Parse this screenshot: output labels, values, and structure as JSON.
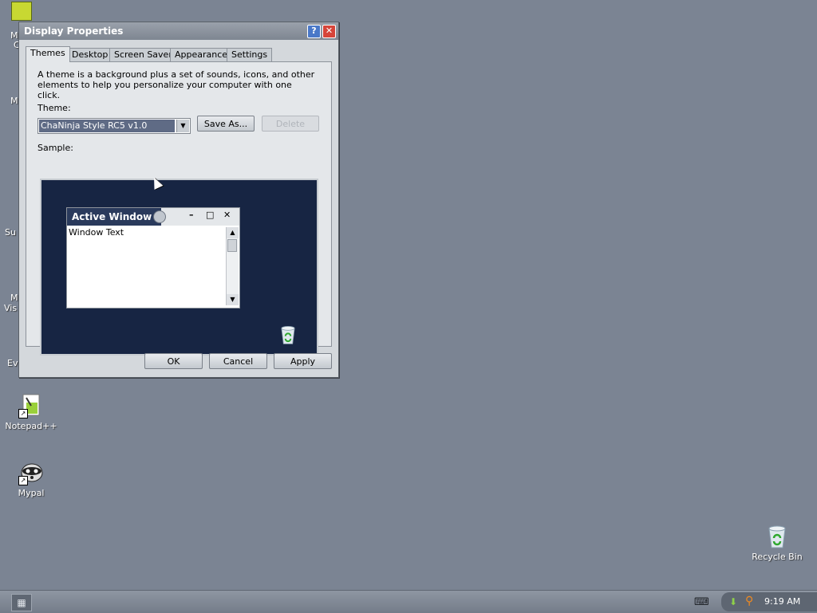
{
  "desktop": {
    "icons": [
      {
        "label": "Notepad++"
      },
      {
        "label": "Mypal"
      },
      {
        "label": "Recycle Bin"
      }
    ],
    "partial_labels": [
      "M",
      "C",
      "M",
      "Su",
      "M",
      "Vis",
      "Ev"
    ]
  },
  "dialog": {
    "title": "Display Properties",
    "help_glyph": "?",
    "close_glyph": "✕",
    "tabs": [
      {
        "label": "Themes",
        "active": true
      },
      {
        "label": "Desktop"
      },
      {
        "label": "Screen Saver"
      },
      {
        "label": "Appearance"
      },
      {
        "label": "Settings"
      }
    ],
    "description": "A theme is a background plus a set of sounds, icons, and other elements to help you personalize your computer with one click.",
    "theme_label": "Theme:",
    "theme_value": "ChaNinja Style RC5 v1.0",
    "save_as_label": "Save As...",
    "delete_label": "Delete",
    "sample_label": "Sample:",
    "sample": {
      "window_title": "Active Window",
      "window_text": "Window Text",
      "min_glyph": "–",
      "max_glyph": "□",
      "close_glyph": "✕"
    },
    "ok_label": "OK",
    "cancel_label": "Cancel",
    "apply_label": "Apply"
  },
  "taskbar": {
    "clock": "9:19 AM"
  },
  "colors": {
    "desktop_bg": "#7b8493",
    "sample_bg": "#172543",
    "titlebar": "#8a929d"
  }
}
